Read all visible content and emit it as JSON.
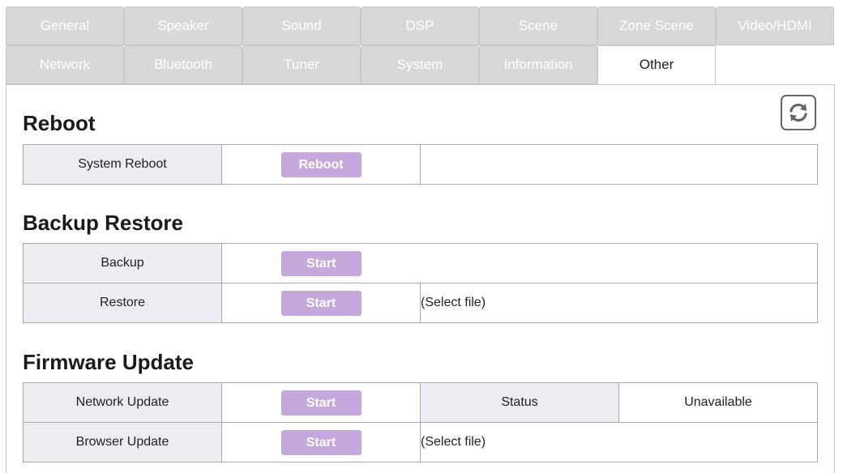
{
  "tabs_row1": [
    "General",
    "Speaker",
    "Sound",
    "DSP",
    "Scene",
    "Zone Scene",
    "Video/HDMI"
  ],
  "tabs_row2": [
    "Network",
    "Bluetooth",
    "Tuner",
    "System",
    "Information",
    "Other"
  ],
  "active_tab": "Other",
  "refresh_icon": "refresh-icon",
  "reboot": {
    "title": "Reboot",
    "row_label": "System Reboot",
    "button": "Reboot"
  },
  "backup_restore": {
    "title": "Backup Restore",
    "backup_label": "Backup",
    "backup_button": "Start",
    "restore_label": "Restore",
    "restore_button": "Start",
    "restore_file": "(Select file)"
  },
  "firmware": {
    "title": "Firmware Update",
    "network_label": "Network Update",
    "network_button": "Start",
    "status_label": "Status",
    "status_value": "Unavailable",
    "browser_label": "Browser Update",
    "browser_button": "Start",
    "browser_file": "(Select file)"
  },
  "colors": {
    "accent_button": "#c6a9dc",
    "tab_inactive": "#d8d8d8",
    "label_cell": "#ececf2"
  }
}
